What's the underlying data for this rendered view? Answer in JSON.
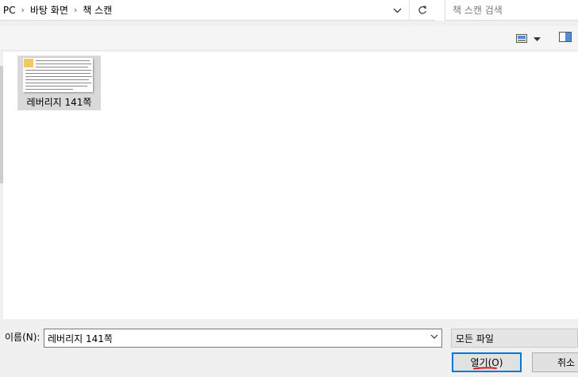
{
  "address_bar": {
    "breadcrumbs": [
      "내 PC",
      "바탕 화면",
      "책 스캔"
    ],
    "separator": "›",
    "icons": {
      "dropdown": "chevron-down-icon",
      "refresh": "refresh-icon",
      "separator": "chevron-right-icon"
    }
  },
  "search": {
    "placeholder": "책 스캔 검색"
  },
  "toolbar": {
    "icons": [
      "view-mode-icon",
      "chevron-down-icon",
      "preview-pane-icon"
    ]
  },
  "files": [
    {
      "name": "레버리지 141쪽",
      "selected": true,
      "thumbnail": "document-page-thumbnail"
    }
  ],
  "footer": {
    "filename_label": "이름(N):",
    "filename_value": "레버리지 141쪽",
    "filter_value": "모든 파일",
    "open_label": "열기(O)",
    "cancel_label": "취소"
  },
  "colors": {
    "accent": "#0078d7",
    "selection": "#d9d9d9",
    "annotation": "#e01a1a",
    "background": "#f0f0f0"
  }
}
